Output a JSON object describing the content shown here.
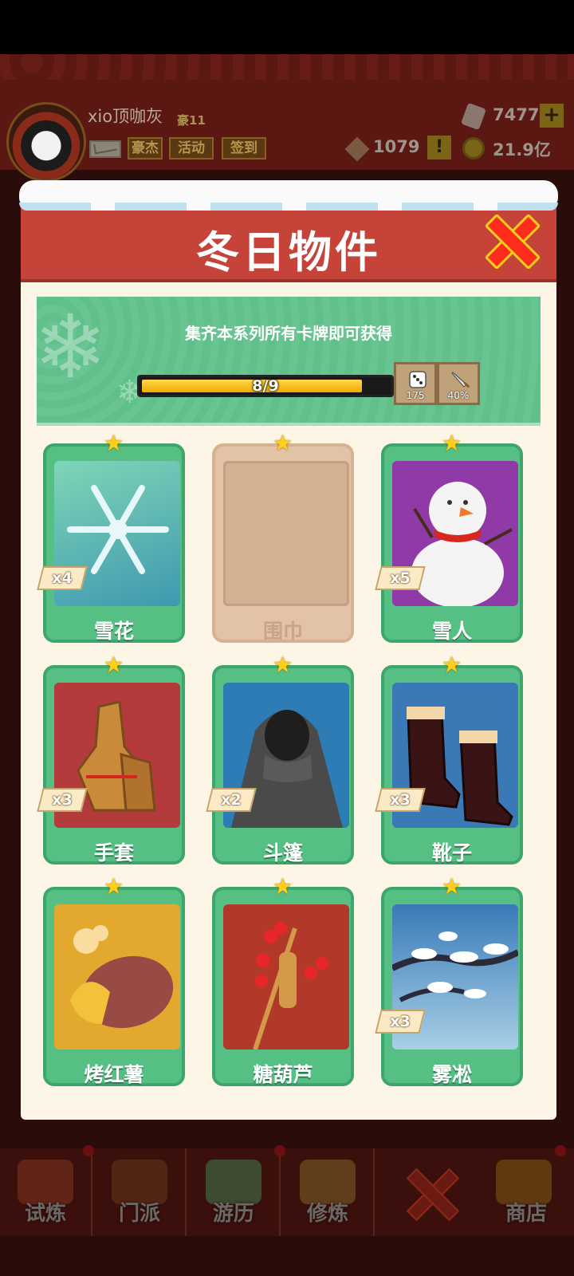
{
  "hud": {
    "player_name": "xio顶咖灰",
    "player_level": "豪11",
    "buttons": [
      "豪杰",
      "活动",
      "签到"
    ],
    "gems": "7477",
    "diamonds": "1079",
    "gold": "21.9亿",
    "plus_label": "+",
    "alert_label": "!"
  },
  "modal": {
    "title": "冬日物件",
    "banner_text": "集齐本系列所有卡牌即可获得",
    "progress": {
      "label": "8/9",
      "collected": 8,
      "total": 9
    },
    "rewards": [
      {
        "icon": "dice-icon",
        "value": "175"
      },
      {
        "icon": "sword-icon",
        "value": "40%"
      }
    ],
    "cards": [
      {
        "name": "雪花",
        "count": "x4",
        "collected": true,
        "art": "snowflake"
      },
      {
        "name": "围巾",
        "count": "",
        "collected": false,
        "art": "scarf"
      },
      {
        "name": "雪人",
        "count": "x5",
        "collected": true,
        "art": "snowman"
      },
      {
        "name": "手套",
        "count": "x3",
        "collected": true,
        "art": "gloves"
      },
      {
        "name": "斗篷",
        "count": "x2",
        "collected": true,
        "art": "cloak"
      },
      {
        "name": "靴子",
        "count": "x3",
        "collected": true,
        "art": "boots"
      },
      {
        "name": "烤红薯",
        "count": "",
        "collected": true,
        "art": "sweet-potato"
      },
      {
        "name": "糖葫芦",
        "count": "",
        "collected": true,
        "art": "candied-haws"
      },
      {
        "name": "雾凇",
        "count": "x3",
        "collected": true,
        "art": "rime"
      }
    ]
  },
  "bottom_nav": {
    "tabs": [
      "试炼",
      "门派",
      "游历",
      "修炼",
      "",
      "商店"
    ]
  },
  "colors": {
    "header_red": "#c6433a",
    "card_green": "#56c084",
    "progress_yellow": "#ffd94a",
    "close_red": "#ff2b1c"
  }
}
